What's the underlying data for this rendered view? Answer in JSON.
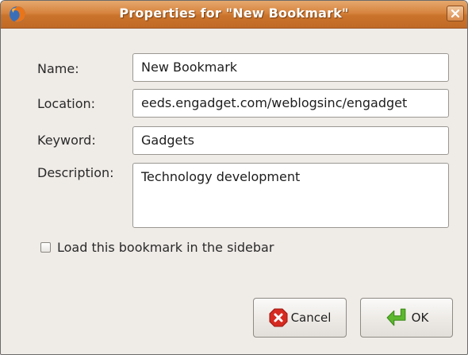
{
  "window": {
    "title": "Properties for \"New Bookmark\""
  },
  "form": {
    "name_label": "Name:",
    "name_value": "New Bookmark",
    "location_label": "Location:",
    "location_value": "eeds.engadget.com/weblogsinc/engadget",
    "keyword_label": "Keyword:",
    "keyword_value": "Gadgets",
    "description_label": "Description:",
    "description_value": "Technology development",
    "sidebar_checkbox_label": "Load this bookmark in the sidebar",
    "sidebar_checkbox_checked": false
  },
  "buttons": {
    "cancel_label": "Cancel",
    "ok_label": "OK"
  },
  "icons": {
    "app": "firefox-icon",
    "close": "close-icon",
    "cancel": "cancel-icon",
    "ok": "ok-arrow-icon"
  },
  "colors": {
    "titlebar": "#d6843e",
    "window_bg": "#efebe7",
    "cancel_icon": "#d62a20",
    "ok_icon": "#5cb82e"
  }
}
